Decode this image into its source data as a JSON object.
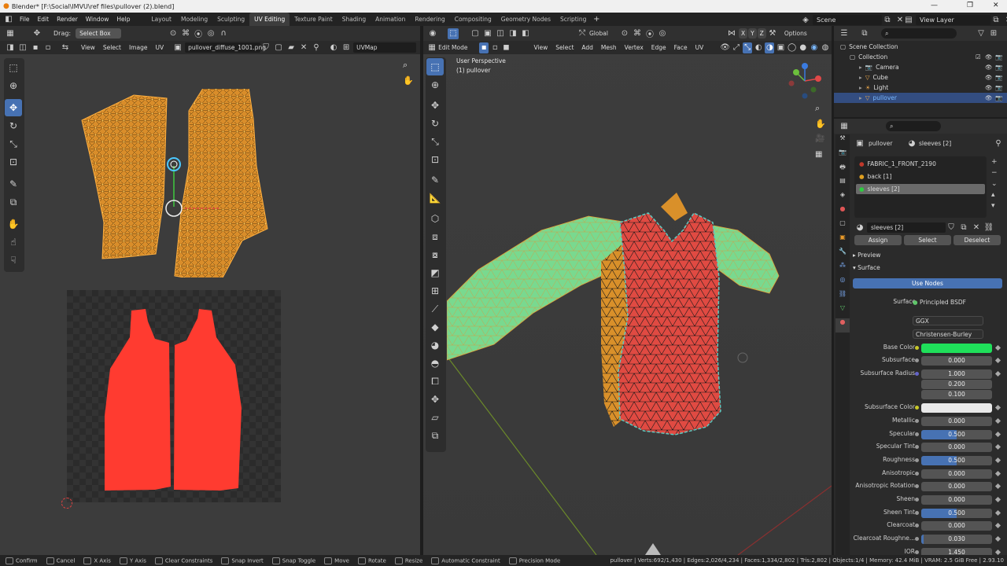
{
  "titlebar": {
    "title": "Blender* [F:\\Social\\IMVU\\ref files\\pullover (2).blend]"
  },
  "menus": [
    "File",
    "Edit",
    "Render",
    "Window",
    "Help"
  ],
  "workspaces": [
    {
      "label": "Layout",
      "active": false
    },
    {
      "label": "Modeling",
      "active": false
    },
    {
      "label": "Sculpting",
      "active": false
    },
    {
      "label": "UV Editing",
      "active": true
    },
    {
      "label": "Texture Paint",
      "active": false
    },
    {
      "label": "Shading",
      "active": false
    },
    {
      "label": "Animation",
      "active": false
    },
    {
      "label": "Rendering",
      "active": false
    },
    {
      "label": "Compositing",
      "active": false
    },
    {
      "label": "Geometry Nodes",
      "active": false
    },
    {
      "label": "Scripting",
      "active": false
    }
  ],
  "scene": {
    "name": "Scene",
    "view_layer": "View Layer"
  },
  "uv_editor": {
    "drag_label": "Drag:",
    "drag_value": "Select Box",
    "menus": [
      "View",
      "Select",
      "Image",
      "UV"
    ],
    "image_name": "pullover_diffuse_1001.png",
    "uvmap": "UVMap"
  },
  "viewport": {
    "mode": "Edit Mode",
    "menus": [
      "View",
      "Select",
      "Add",
      "Mesh",
      "Vertex",
      "Edge",
      "Face",
      "UV"
    ],
    "orientation": "Global",
    "options_label": "Options",
    "overlay_title": "User Perspective",
    "overlay_object": "(1) pullover",
    "axes": [
      "X",
      "Y",
      "Z"
    ]
  },
  "outliner": {
    "items": [
      {
        "label": "Scene Collection",
        "level": 0,
        "selected": false,
        "icon": "collection-icon"
      },
      {
        "label": "Collection",
        "level": 1,
        "selected": false,
        "icon": "collection-icon"
      },
      {
        "label": "Camera",
        "level": 2,
        "selected": false,
        "icon": "camera-icon"
      },
      {
        "label": "Cube",
        "level": 2,
        "selected": false,
        "icon": "mesh-icon"
      },
      {
        "label": "Light",
        "level": 2,
        "selected": false,
        "icon": "light-icon"
      },
      {
        "label": "pullover",
        "level": 2,
        "selected": true,
        "icon": "mesh-icon"
      }
    ]
  },
  "properties": {
    "object": "pullover",
    "material_slot": "sleeves [2]",
    "slots": [
      {
        "label": "FABRIC_1_FRONT_2190",
        "color": "#c0392b",
        "selected": false
      },
      {
        "label": "back [1]",
        "color": "#e0a020",
        "selected": false
      },
      {
        "label": "sleeves [2]",
        "color": "#2ecc40",
        "selected": true
      }
    ],
    "material_name": "sleeves [2]",
    "actions": [
      "Assign",
      "Select",
      "Deselect"
    ],
    "sections": [
      "Preview",
      "Surface"
    ],
    "use_nodes": "Use Nodes",
    "surface_label": "Surface",
    "surface_value": "Principled BSDF",
    "distribution": "GGX",
    "subsurface_method": "Christensen-Burley",
    "base_color": "#1fe05a",
    "subsurface_color": "#e8e8e8",
    "rows": [
      {
        "label": "Base Color",
        "type": "color",
        "value": "#1fe05a"
      },
      {
        "label": "Subsurface",
        "type": "num",
        "value": "0.000",
        "fill": 0
      },
      {
        "label": "Subsurface Radius",
        "type": "vec",
        "value": "1.000"
      },
      {
        "label": "",
        "type": "vec",
        "value": "0.200"
      },
      {
        "label": "",
        "type": "vec",
        "value": "0.100"
      },
      {
        "label": "Subsurface Color",
        "type": "color",
        "value": "#e8e8e8"
      },
      {
        "label": "Metallic",
        "type": "num",
        "value": "0.000",
        "fill": 0
      },
      {
        "label": "Specular",
        "type": "num",
        "value": "0.500",
        "fill": 0.5
      },
      {
        "label": "Specular Tint",
        "type": "num",
        "value": "0.000",
        "fill": 0
      },
      {
        "label": "Roughness",
        "type": "num",
        "value": "0.500",
        "fill": 0.5
      },
      {
        "label": "Anisotropic",
        "type": "num",
        "value": "0.000",
        "fill": 0
      },
      {
        "label": "Anisotropic Rotation",
        "type": "num",
        "value": "0.000",
        "fill": 0
      },
      {
        "label": "Sheen",
        "type": "num",
        "value": "0.000",
        "fill": 0
      },
      {
        "label": "Sheen Tint",
        "type": "num",
        "value": "0.500",
        "fill": 0.5
      },
      {
        "label": "Clearcoat",
        "type": "num",
        "value": "0.000",
        "fill": 0
      },
      {
        "label": "Clearcoat Roughne...",
        "type": "num",
        "value": "0.030",
        "fill": 0.03
      },
      {
        "label": "IOR",
        "type": "num",
        "value": "1.450",
        "fill": 0
      }
    ]
  },
  "status": {
    "hints": [
      {
        "key": "",
        "label": "Confirm"
      },
      {
        "key": "",
        "label": "Cancel"
      },
      {
        "key": "X",
        "label": "X Axis"
      },
      {
        "key": "Y",
        "label": "Y Axis"
      },
      {
        "key": "C",
        "label": "Clear Constraints"
      },
      {
        "key": "",
        "label": "Snap Invert"
      },
      {
        "key": "",
        "label": "Snap Toggle"
      },
      {
        "key": "G",
        "label": "Move"
      },
      {
        "key": "R",
        "label": "Rotate"
      },
      {
        "key": "S",
        "label": "Resize"
      },
      {
        "key": "",
        "label": "Automatic Constraint"
      },
      {
        "key": "",
        "label": "Precision Mode"
      }
    ],
    "stats": "pullover | Verts:692/1,430 | Edges:2,026/4,234 | Faces:1,334/2,802 | Tris:2,802 | Objects:1/4 | Memory: 42.4 MiB | VRAM: 2.5 GiB Free | 2.93.10"
  }
}
